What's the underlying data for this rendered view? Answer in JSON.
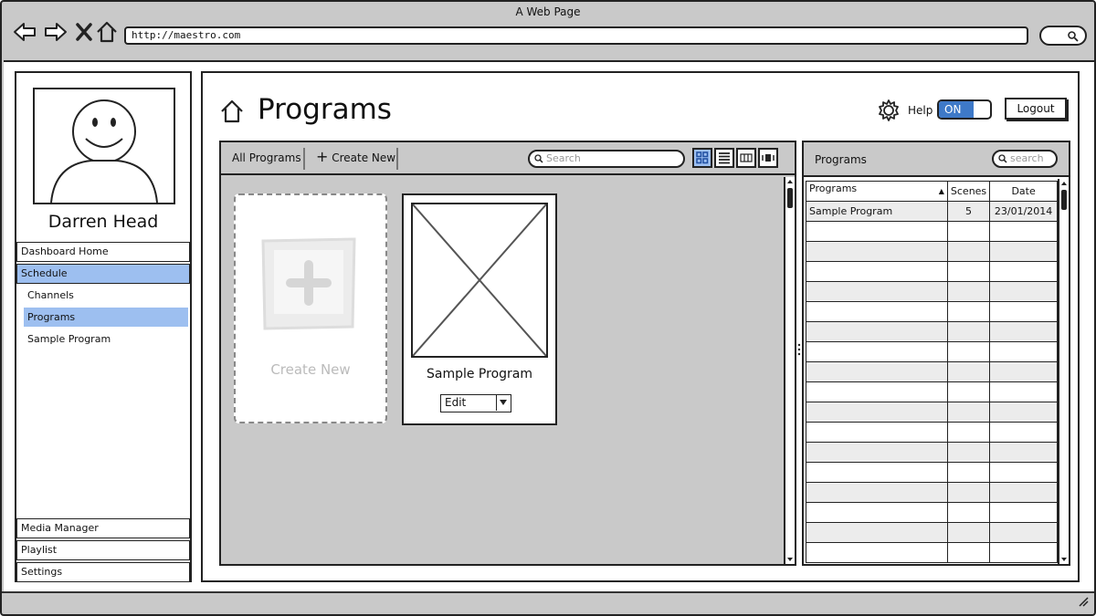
{
  "browser": {
    "title": "A Web Page",
    "url": "http://maestro.com"
  },
  "sidebar": {
    "user_name": "Darren Head",
    "items": [
      {
        "label": "Dashboard Home",
        "active": false
      },
      {
        "label": "Schedule",
        "active": true
      }
    ],
    "sub_items": [
      {
        "label": "Channels",
        "active": false
      },
      {
        "label": "Programs",
        "active": true
      },
      {
        "label": "Sample Program",
        "active": false
      }
    ],
    "bottom_items": [
      {
        "label": "Media Manager"
      },
      {
        "label": "Playlist"
      },
      {
        "label": "Settings"
      }
    ]
  },
  "header": {
    "title": "Programs",
    "help_label": "Help",
    "toggle_label": "ON",
    "logout_label": "Logout"
  },
  "grid": {
    "all_programs_label": "All Programs",
    "create_new_label": "Create New",
    "search_placeholder": "Search",
    "cards": {
      "create_new_label": "Create New",
      "sample_title": "Sample Program",
      "edit_label": "Edit"
    }
  },
  "table_panel": {
    "title": "Programs",
    "search_placeholder": "search",
    "columns": [
      "Programs",
      "Scenes",
      "Date"
    ],
    "rows": [
      [
        "Sample Program",
        "5",
        "23/01/2014"
      ]
    ]
  },
  "colors": {
    "accent": "#9dbff0",
    "toggle_on": "#3e79c8",
    "chrome": "#c9c9c9"
  }
}
